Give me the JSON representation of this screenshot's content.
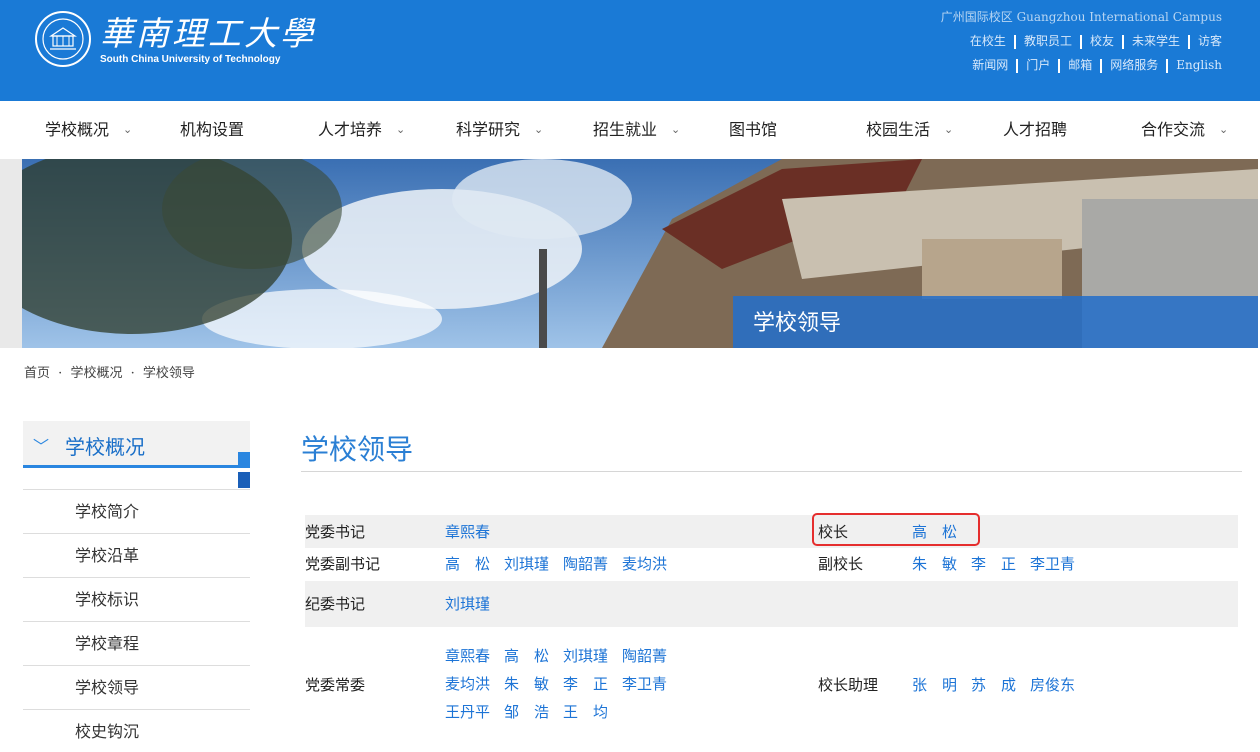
{
  "header": {
    "logo_cn": "華南理工大學",
    "logo_en": "South China University of Technology",
    "campus": "广州国际校区  Guangzhou International Campus",
    "links_row1": [
      "在校生",
      "教职员工",
      "校友",
      "未来学生",
      "访客"
    ],
    "links_row2": [
      "新闻网",
      "门户",
      "邮箱",
      "网络服务",
      "English"
    ]
  },
  "nav": {
    "items": [
      {
        "label": "学校概况",
        "dropdown": true
      },
      {
        "label": "机构设置",
        "dropdown": false
      },
      {
        "label": "人才培养",
        "dropdown": true
      },
      {
        "label": "科学研究",
        "dropdown": true
      },
      {
        "label": "招生就业",
        "dropdown": true
      },
      {
        "label": "图书馆",
        "dropdown": false
      },
      {
        "label": "校园生活",
        "dropdown": true
      },
      {
        "label": "人才招聘",
        "dropdown": false
      },
      {
        "label": "合作交流",
        "dropdown": true
      }
    ]
  },
  "banner": {
    "title": "学校领导"
  },
  "breadcrumb": [
    "首页",
    "·",
    "学校概况",
    "·",
    "学校领导"
  ],
  "sidebar": {
    "title": "学校概况",
    "items": [
      "学校简介",
      "学校沿革",
      "学校标识",
      "学校章程",
      "学校领导",
      "校史钩沉"
    ]
  },
  "content": {
    "title": "学校领导",
    "rows": [
      {
        "left_label": "党委书记",
        "left_values": [
          "章熙春"
        ],
        "right_label": "校长",
        "right_values": [
          "高　松"
        ]
      },
      {
        "left_label": "党委副书记",
        "left_values": [
          "高　松",
          "刘琪瑾",
          "陶韶菁",
          "麦均洪"
        ],
        "right_label": "副校长",
        "right_values": [
          "朱　敏",
          "李　正",
          "李卫青"
        ]
      },
      {
        "left_label": "纪委书记",
        "left_values": [
          "刘琪瑾"
        ],
        "right_label": "",
        "right_values": []
      },
      {
        "left_label": "党委常委",
        "left_values_lines": [
          [
            "章熙春",
            "高　松",
            "刘琪瑾",
            "陶韶菁"
          ],
          [
            "麦均洪",
            "朱　敏",
            "李　正",
            "李卫青"
          ],
          [
            "王丹平",
            "邹　浩",
            "王　均"
          ]
        ],
        "right_label": "校长助理",
        "right_values": [
          "张　明",
          "苏　成",
          "房俊东"
        ]
      }
    ]
  },
  "colors": {
    "header_bg": "#1a7ad6",
    "accent": "#2a7fd4",
    "highlight": "#e52e2e"
  }
}
